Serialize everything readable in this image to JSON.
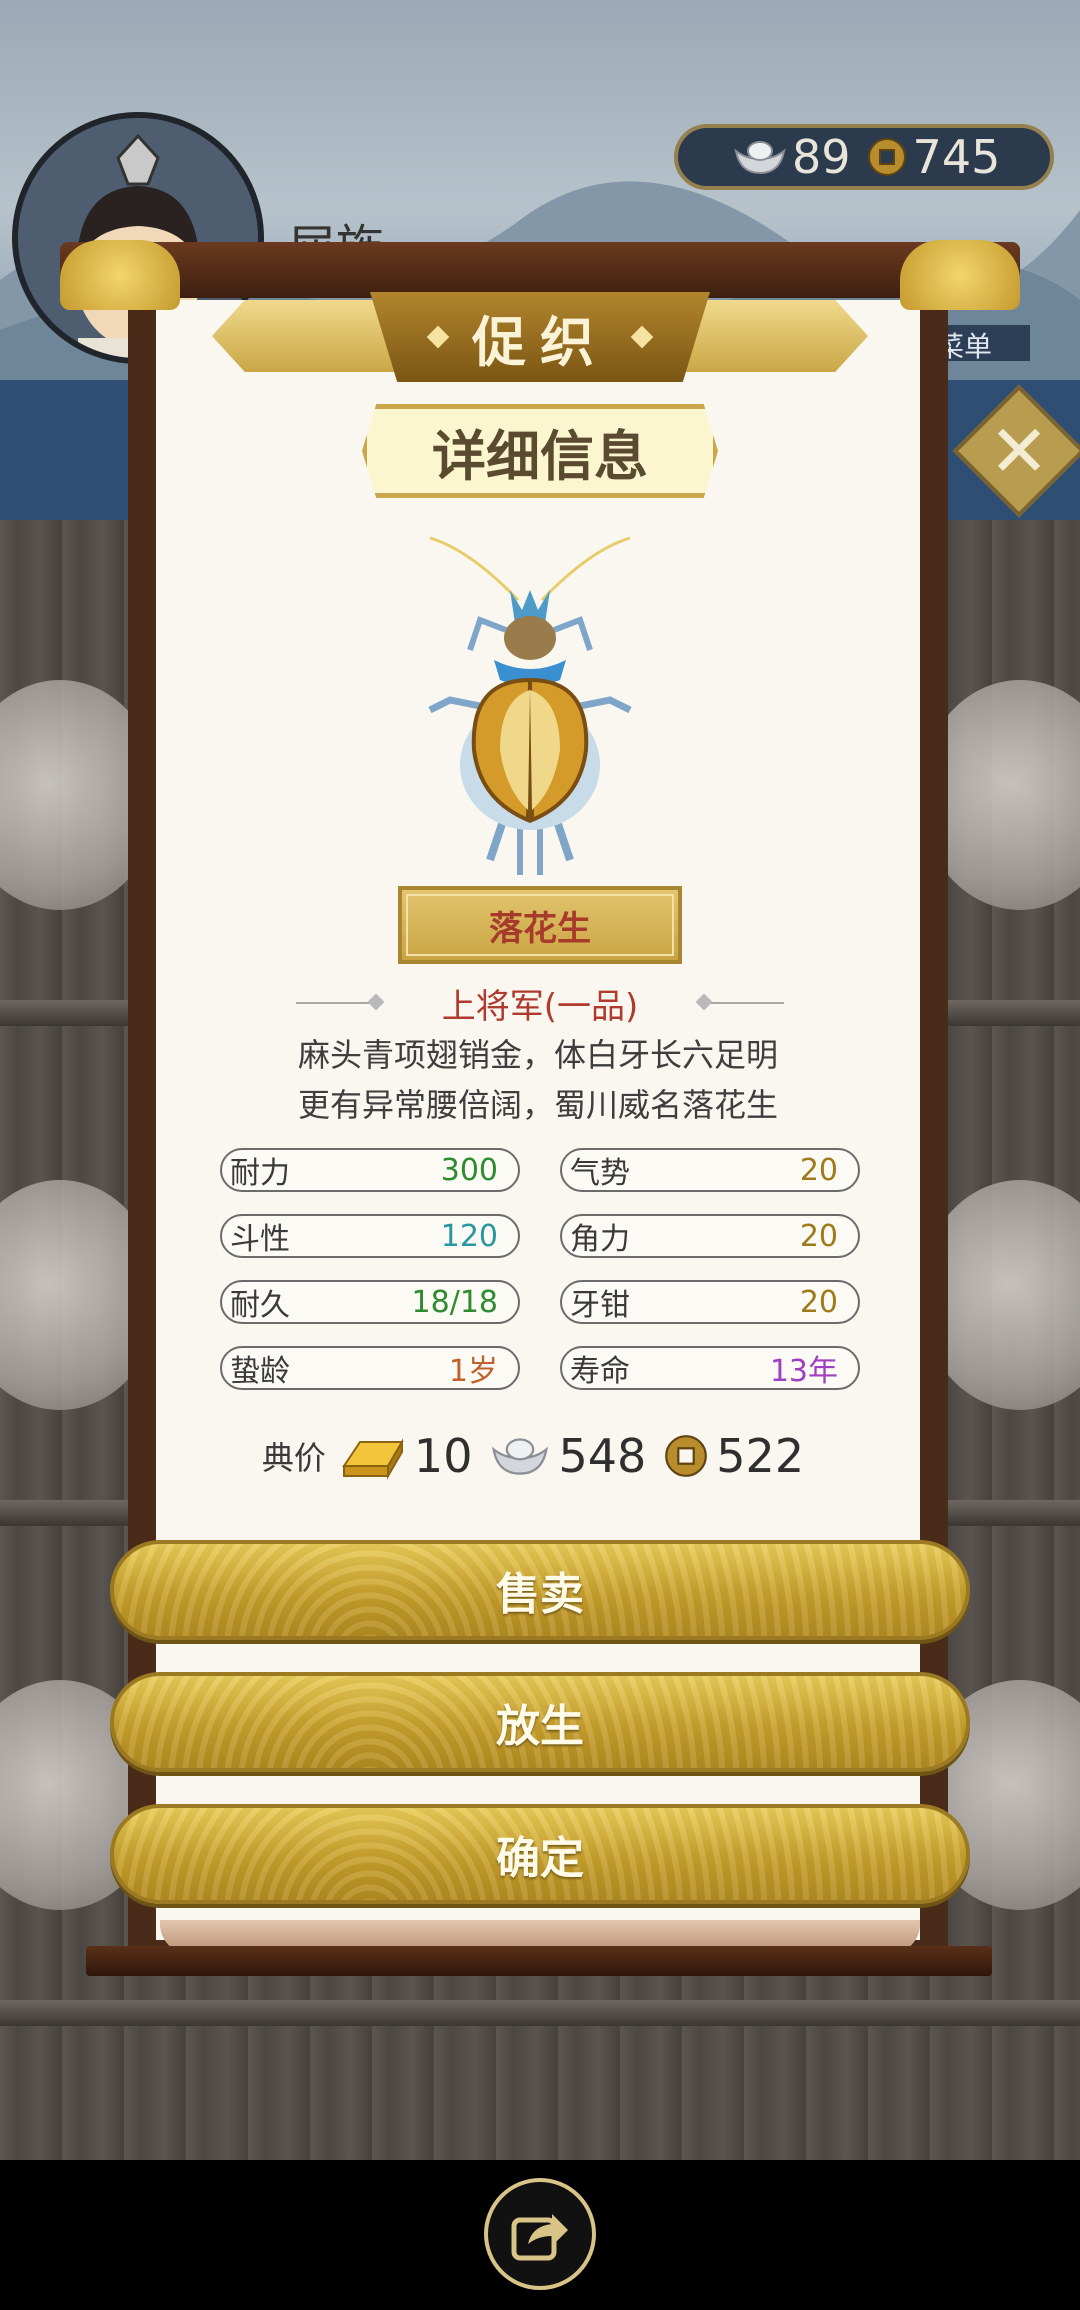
{
  "player": {
    "name": "屈旌"
  },
  "currency": {
    "silver": "89",
    "coins": "745"
  },
  "menu_label": "菜单",
  "dialog": {
    "header_title": "促织",
    "subtitle": "详细信息",
    "cricket_name": "落花生",
    "rank": "上将军(一品)",
    "poem_line1": "麻头青项翅销金，体白牙长六足明",
    "poem_line2": "更有异常腰倍阔，蜀川威名落花生",
    "stats": [
      {
        "label": "耐力",
        "value": "300",
        "color": "#2e8b2e"
      },
      {
        "label": "气势",
        "value": "20",
        "color": "#a07a1a"
      },
      {
        "label": "斗性",
        "value": "120",
        "color": "#2a96a0"
      },
      {
        "label": "角力",
        "value": "20",
        "color": "#a07a1a"
      },
      {
        "label": "耐久",
        "value": "18/18",
        "color": "#2e8b2e"
      },
      {
        "label": "牙钳",
        "value": "20",
        "color": "#a07a1a"
      },
      {
        "label": "蛰龄",
        "value": "1岁",
        "color": "#c0602a"
      },
      {
        "label": "寿命",
        "value": "13年",
        "color": "#a040c0"
      }
    ],
    "price_label": "典价",
    "price_gold": "10",
    "price_silver": "548",
    "price_coins": "522",
    "buttons": {
      "sell": "售卖",
      "release": "放生",
      "confirm": "确定"
    }
  },
  "icons": [
    "silver-ingot-icon",
    "copper-coin-icon",
    "gold-bar-icon",
    "close-icon",
    "share-icon"
  ]
}
